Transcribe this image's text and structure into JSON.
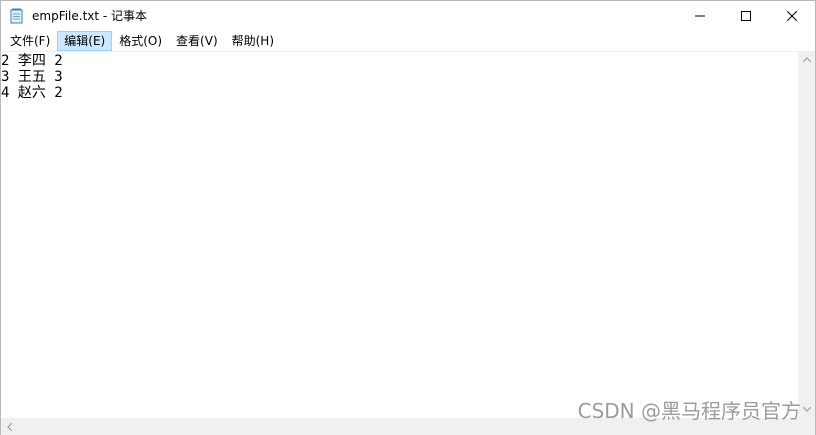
{
  "window": {
    "title": "empFile.txt - 记事本"
  },
  "menu": {
    "items": [
      {
        "label": "文件(F)"
      },
      {
        "label": "编辑(E)"
      },
      {
        "label": "格式(O)"
      },
      {
        "label": "查看(V)"
      },
      {
        "label": "帮助(H)"
      }
    ],
    "active_index": 1
  },
  "editor": {
    "lines": [
      "2 李四 2",
      "3 王五 3",
      "4 赵六 2"
    ]
  },
  "watermark": {
    "text": "CSDN @黑马程序员官方"
  },
  "colors": {
    "menu_active_bg": "#cce8ff",
    "menu_active_border": "#99d1ff",
    "scrollbar_bg": "#f0f0f0"
  },
  "icons": {
    "app": "notepad-icon",
    "minimize": "minimize-icon",
    "maximize": "maximize-icon",
    "close": "close-icon"
  }
}
